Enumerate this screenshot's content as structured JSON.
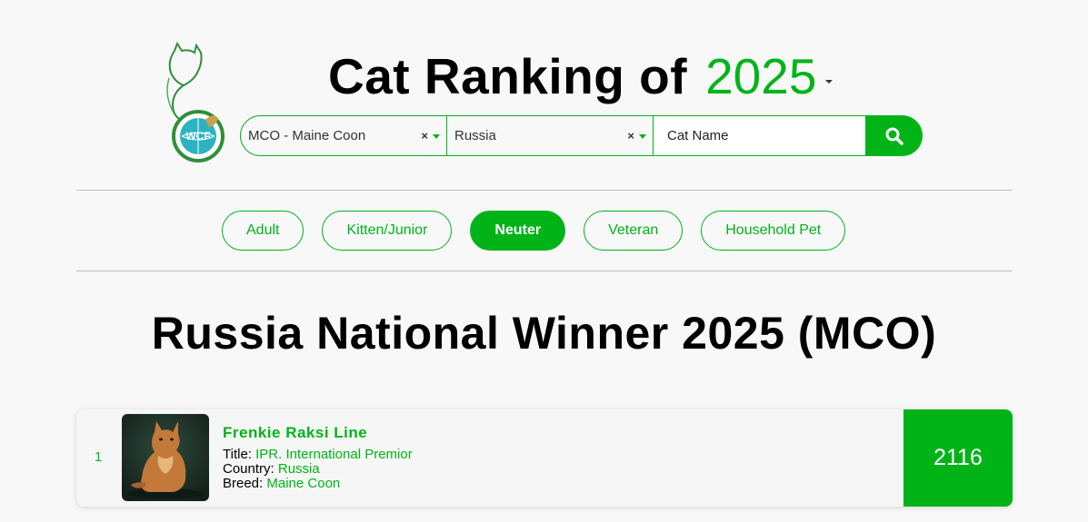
{
  "header": {
    "title": "Cat Ranking of",
    "year": "2025",
    "logo_text": "WCF"
  },
  "search": {
    "breed_value": "MCO - Maine Coon",
    "country_value": "Russia",
    "name_placeholder": "Cat Name",
    "clear_glyph": "×"
  },
  "tabs": [
    {
      "label": "Adult",
      "active": false
    },
    {
      "label": "Kitten/Junior",
      "active": false
    },
    {
      "label": "Neuter",
      "active": true
    },
    {
      "label": "Veteran",
      "active": false
    },
    {
      "label": "Household Pet",
      "active": false
    }
  ],
  "heading": "Russia National Winner 2025 (MCO)",
  "results": [
    {
      "rank": "1",
      "name": "Frenkie Raksi Line",
      "title_label": "Title:",
      "title_value": "IPR. International Premior",
      "country_label": "Country:",
      "country_value": "Russia",
      "breed_label": "Breed:",
      "breed_value": "Maine Coon",
      "score": "2116"
    }
  ],
  "colors": {
    "accent": "#00b418",
    "background": "#f8f8f8",
    "divider": "#bdbdbd"
  },
  "icons": {
    "search": "search-icon",
    "caret": "chevron-down-icon",
    "clear": "clear-icon"
  }
}
